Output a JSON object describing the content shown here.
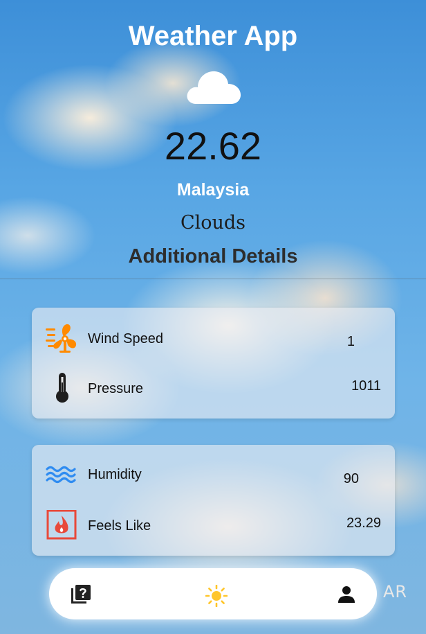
{
  "app": {
    "title": "Weather App"
  },
  "weather": {
    "icon": "cloud-icon",
    "temperature": "22.62",
    "country": "Malaysia",
    "condition": "Clouds"
  },
  "details": {
    "section_title": "Additional Details",
    "cards": [
      {
        "rows": [
          {
            "icon": "wind-fan-icon",
            "label": "Wind Speed",
            "value": "1"
          },
          {
            "icon": "thermometer-icon",
            "label": "Pressure",
            "value": "1011"
          }
        ]
      },
      {
        "rows": [
          {
            "icon": "water-waves-icon",
            "label": "Humidity",
            "value": "90"
          },
          {
            "icon": "fire-icon",
            "label": "Feels Like",
            "value": "23.29"
          }
        ]
      }
    ]
  },
  "nav": {
    "items": [
      {
        "icon": "faq-quiz-icon"
      },
      {
        "icon": "sun-icon",
        "active_color": "#FFC62B"
      },
      {
        "icon": "person-icon"
      }
    ],
    "language_toggle": "AR"
  },
  "colors": {
    "title": "#FFFFFF",
    "accent_orange": "#FF8A00",
    "accent_blue": "#2F8CF1",
    "fire_red": "#E8493A"
  }
}
